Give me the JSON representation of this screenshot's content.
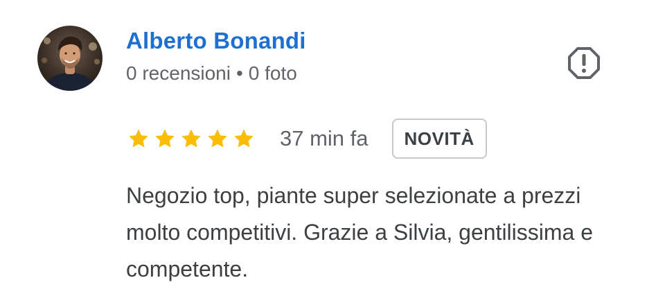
{
  "review": {
    "author": {
      "name": "Alberto Bonandi",
      "reviews_count": "0 recensioni",
      "separator": "•",
      "photos_count": "0 foto"
    },
    "rating": {
      "stars": 5,
      "max_stars": 5,
      "star_color": "#fbbc04"
    },
    "time_ago": "37 min fa",
    "badge": "NOVITÀ",
    "text": "Negozio top, piante super selezionate a prezzi molto competitivi. Grazie a Silvia, gentilissima e competente.",
    "report_icon": "report-flag-icon"
  },
  "colors": {
    "author_name": "#1f6fd1",
    "meta_text": "#5f6368",
    "body_text": "#3c4043",
    "badge_border": "#c8c8c8"
  }
}
